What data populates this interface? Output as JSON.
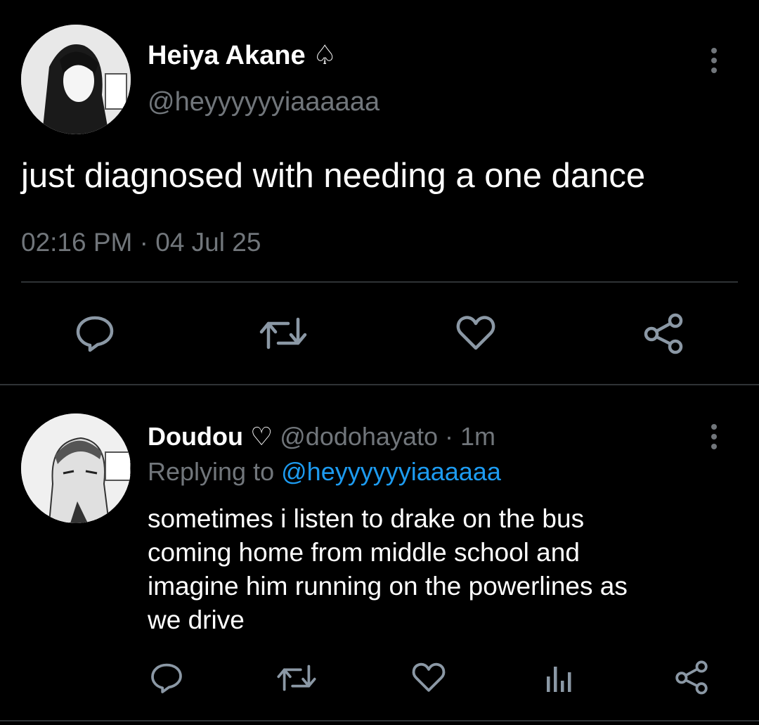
{
  "main_tweet": {
    "author_name": "Heiya Akane",
    "author_badge": "♤",
    "handle": "@heyyyyyyiaaaaaa",
    "text": "just diagnosed with needing a one dance",
    "timestamp": "02:16 PM · 04 Jul 25",
    "actions": [
      "reply-icon",
      "retweet-icon",
      "like-icon",
      "share-icon"
    ]
  },
  "reply_tweet": {
    "author_name": "Doudou",
    "author_badge": "♡",
    "handle": "@dodohayato",
    "age": "· 1m",
    "replying_prefix": "Replying to",
    "replying_handle": "@heyyyyyyiaaaaaa",
    "text_lines": [
      "sometimes i listen to drake on the bus",
      "coming home from middle school and",
      "imagine him running on the powerlines as",
      "we drive"
    ],
    "actions": [
      "reply-icon",
      "retweet-icon",
      "like-icon",
      "analytics-icon",
      "share-icon"
    ]
  },
  "colors": {
    "background": "#000000",
    "text": "#e7e9ea",
    "secondary": "#71767b",
    "link": "#1d9bf0",
    "divider": "#2f3336"
  }
}
